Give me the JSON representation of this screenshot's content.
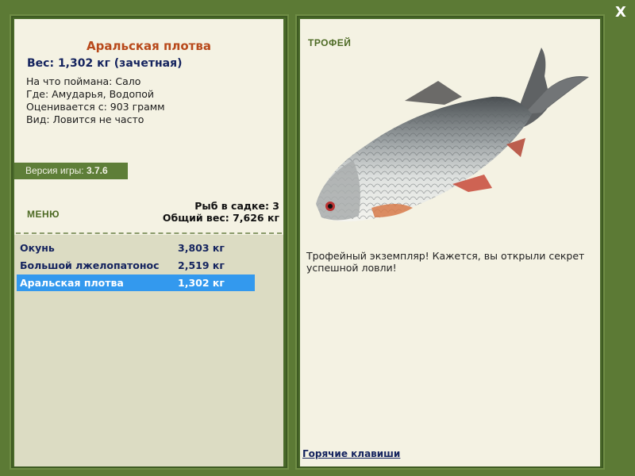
{
  "close_label": "X",
  "fish": {
    "title": "Аральская плотва",
    "weight": "Вес: 1,302 кг (зачетная)",
    "bait": "На что поймана: Сало",
    "location": "Где: Амударья, Водопой",
    "rated_from": "Оценивается с: 903 грамм",
    "kind": "Вид: Ловится не часто"
  },
  "version": {
    "label": "Версия игры:",
    "number": "3.7.6"
  },
  "menu_label": "МЕНЮ",
  "stats": {
    "count": "Рыб в садке: 3",
    "total": "Общий вес: 7,626 кг"
  },
  "catch_list": [
    {
      "name": "Окунь",
      "weight": "3,803 кг"
    },
    {
      "name": "Большой лжелопатонос",
      "weight": "2,519 кг"
    },
    {
      "name": "Аральская плотва",
      "weight": "1,302 кг"
    }
  ],
  "trophy": {
    "label": "ТРОФЕЙ",
    "text": "Трофейный экземпляр! Кажется, вы открыли секрет успешной ловли!"
  },
  "hotkeys_label": "Горячие клавиши",
  "colors": {
    "background": "#5c7a35",
    "panel": "#f4f2e3",
    "selected_row": "#3399ee",
    "title": "#b8491b"
  }
}
